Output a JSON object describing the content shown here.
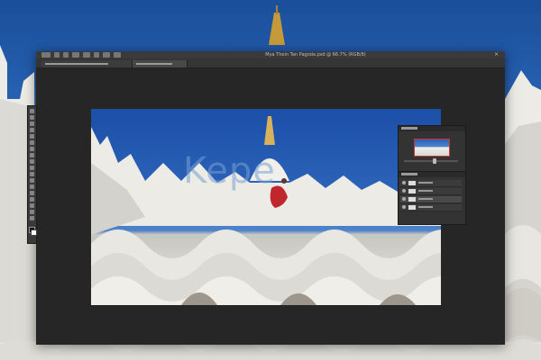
{
  "app": {
    "document_title": "Mya Thein Tan Pagoda.psd @ 66.7% (RGB/8)",
    "window_control": "×"
  },
  "tabs": [
    {
      "label": "Mya Thein Tan Pagoda.psd",
      "active": true
    },
    {
      "label": "Untitled-1",
      "active": false
    }
  ],
  "workspace": {
    "background_color": "#262626"
  },
  "toolbar": {
    "tools": [
      "move-icon",
      "marquee-icon",
      "lasso-icon",
      "quick-select-icon",
      "crop-icon",
      "eyedropper-icon",
      "healing-icon",
      "brush-icon",
      "clone-stamp-icon",
      "history-brush-icon",
      "eraser-icon",
      "gradient-icon",
      "blur-icon",
      "dodge-icon",
      "pen-icon",
      "type-icon",
      "path-select-icon",
      "shape-icon",
      "hand-icon",
      "zoom-icon"
    ],
    "foreground_color": "#111111",
    "background_color": "#ffffff"
  },
  "navigator_panel": {
    "zoom_level_percent": 66.7
  },
  "layers_panel": {
    "rows": 4
  },
  "watermark": {
    "text": "Kepe"
  },
  "colors": {
    "sky": "#2a66b8",
    "stupa_white": "#ecebe6",
    "monk_robe": "#c0262d",
    "panel_bg": "#333333"
  }
}
